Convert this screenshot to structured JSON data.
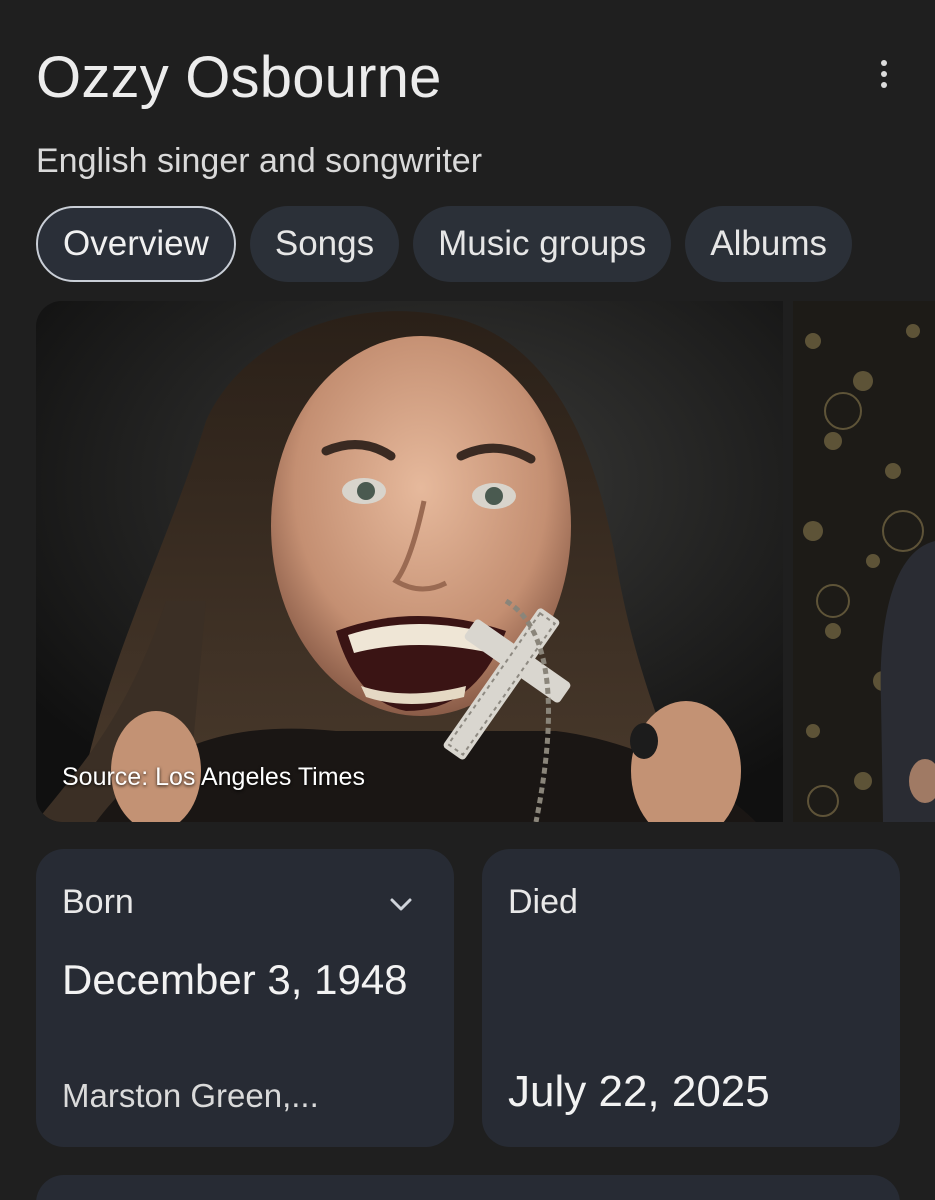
{
  "header": {
    "title": "Ozzy Osbourne",
    "subtitle": "English singer and songwriter",
    "more_icon": "more-vert-icon"
  },
  "tabs": [
    {
      "label": "Overview",
      "active": true
    },
    {
      "label": "Songs",
      "active": false
    },
    {
      "label": "Music groups",
      "active": false
    },
    {
      "label": "Albums",
      "active": false
    }
  ],
  "media": {
    "source_caption": "Source: Los Angeles Times"
  },
  "facts": {
    "born": {
      "label": "Born",
      "date": "December 3, 1948",
      "place": "Marston Green,...",
      "expand_icon": "chevron-down-icon"
    },
    "died": {
      "label": "Died",
      "date": "July 22, 2025"
    }
  },
  "colors": {
    "background": "#1f1f1f",
    "chip": "#2b3038",
    "card": "#272b34",
    "text": "#e3e3e3"
  }
}
